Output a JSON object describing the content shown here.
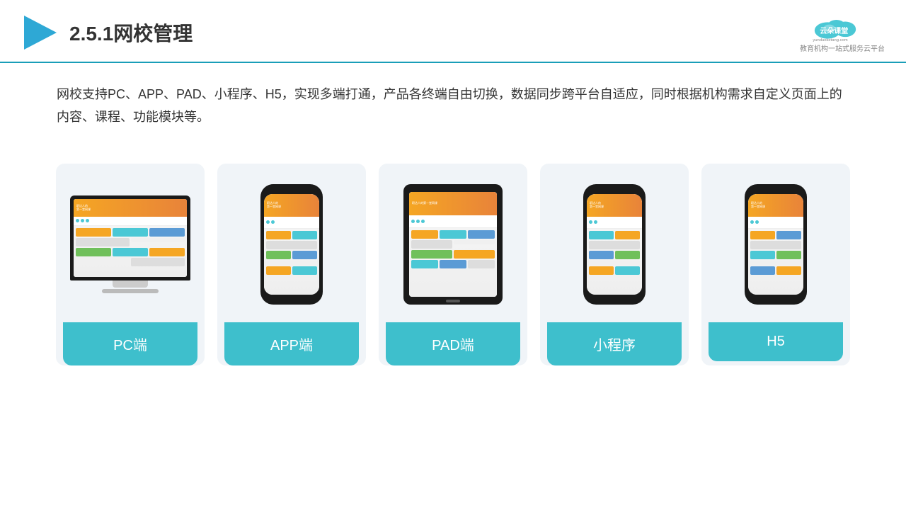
{
  "header": {
    "title": "2.5.1网校管理",
    "logo_name": "云朵课堂",
    "logo_url": "yunduoketang.com",
    "logo_sub": "教育机构一站式服务云平台"
  },
  "description": {
    "text": "网校支持PC、APP、PAD、小程序、H5，实现多端打通，产品各终端自由切换，数据同步跨平台自适应，同时根据机构需求自定义页面上的内容、课程、功能模块等。"
  },
  "cards": [
    {
      "id": "pc",
      "label": "PC端",
      "device": "pc"
    },
    {
      "id": "app",
      "label": "APP端",
      "device": "phone"
    },
    {
      "id": "pad",
      "label": "PAD端",
      "device": "tablet"
    },
    {
      "id": "miniapp",
      "label": "小程序",
      "device": "phone"
    },
    {
      "id": "h5",
      "label": "H5",
      "device": "phone"
    }
  ]
}
